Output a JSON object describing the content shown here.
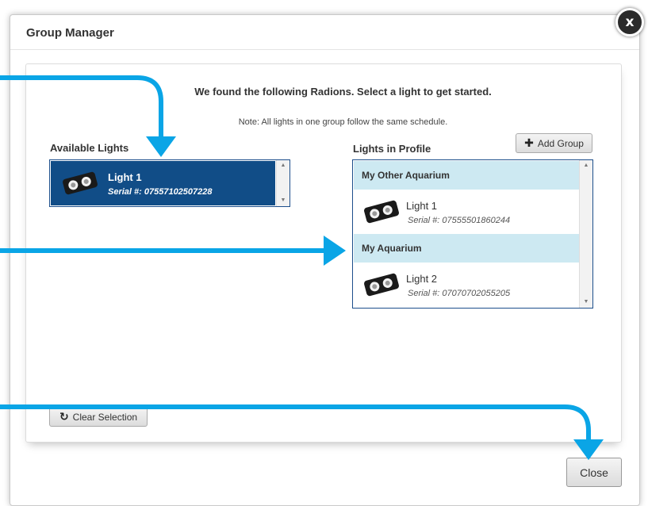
{
  "dialog": {
    "title": "Group Manager",
    "close_icon_glyph": "x"
  },
  "main": {
    "headline": "We found the following Radions. Select a light to get started.",
    "note": "Note: All lights in one group follow the same schedule."
  },
  "available": {
    "title": "Available Lights",
    "items": [
      {
        "name": "Light 1",
        "serial": "Serial #: 07557102507228",
        "selected": true
      }
    ]
  },
  "profile": {
    "title": "Lights in Profile",
    "add_group_label": "Add Group",
    "add_group_icon": "plus-icon",
    "groups": [
      {
        "name": "My Other Aquarium",
        "lights": [
          {
            "name": "Light 1",
            "serial": "Serial #: 07555501860244"
          }
        ]
      },
      {
        "name": "My Aquarium",
        "lights": [
          {
            "name": "Light 2",
            "serial": "Serial #: 07070702055205"
          }
        ]
      }
    ]
  },
  "footer": {
    "clear_label": "Clear Selection",
    "clear_icon": "refresh-icon",
    "close_label": "Close"
  },
  "colors": {
    "selected_blue": "#114d87",
    "group_header": "#cde9f2",
    "annotation_arrow": "#0aa5e6"
  }
}
